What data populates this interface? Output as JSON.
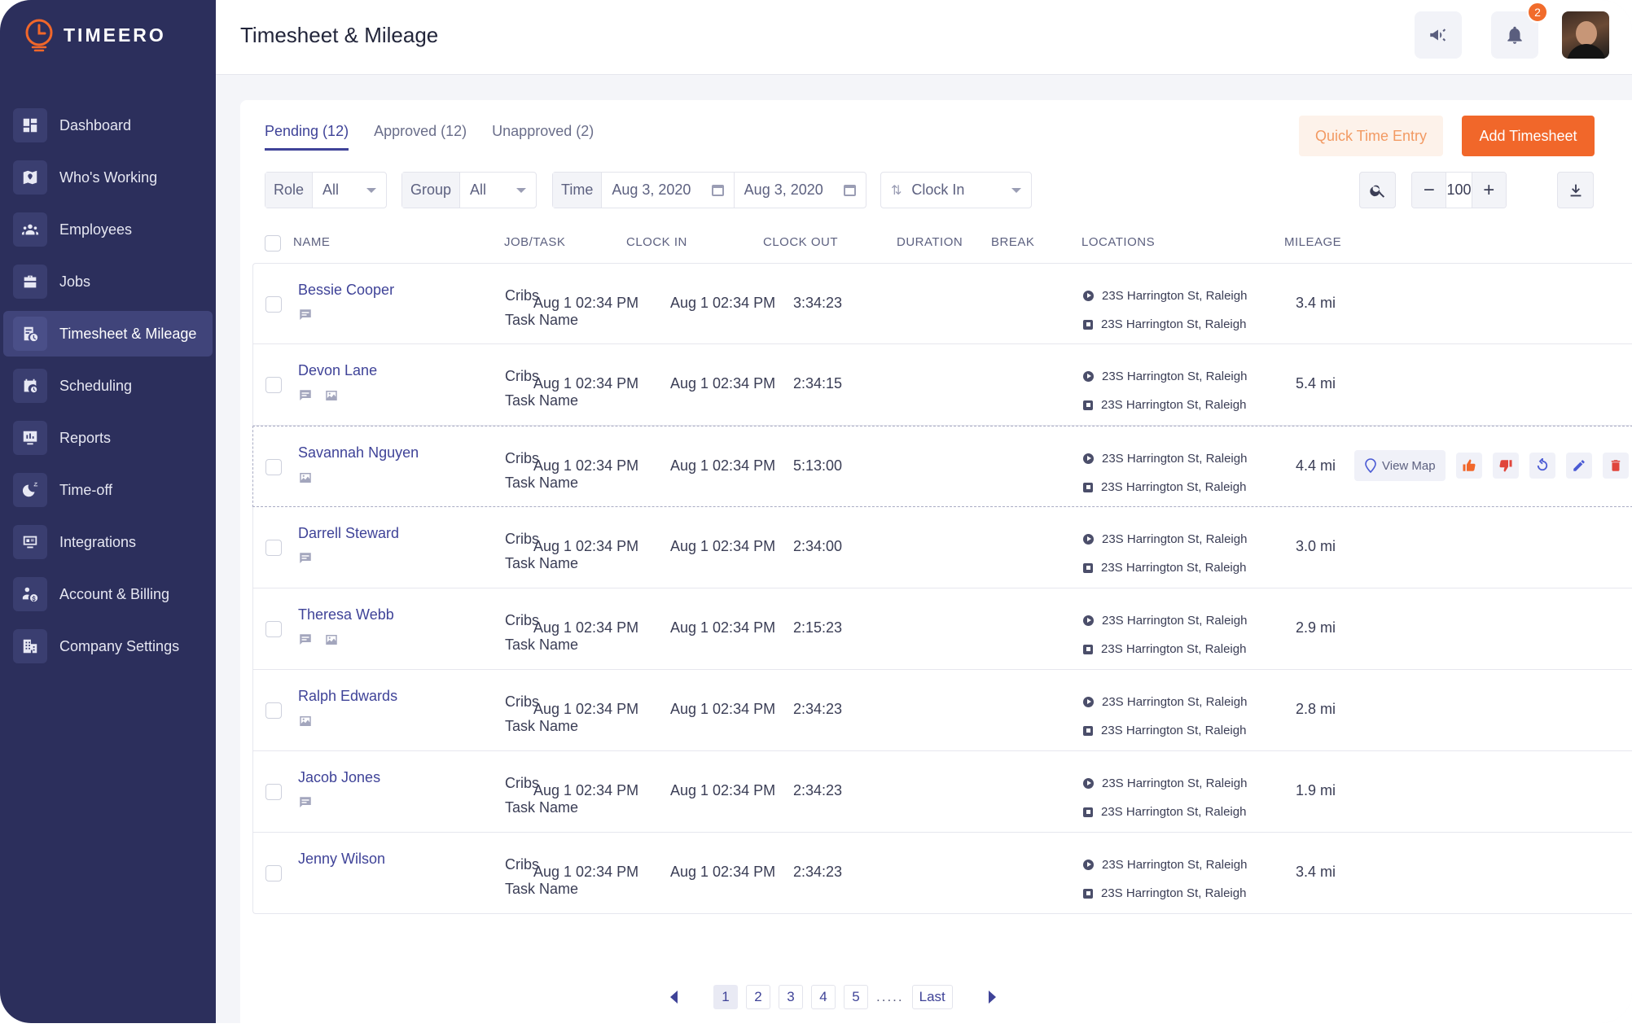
{
  "brand": {
    "name": "TIMEERO"
  },
  "header": {
    "title": "Timesheet & Mileage",
    "notification_count": "2"
  },
  "sidebar": {
    "items": [
      {
        "label": "Dashboard",
        "icon": "dashboard-icon"
      },
      {
        "label": "Who's Working",
        "icon": "map-icon"
      },
      {
        "label": "Employees",
        "icon": "employees-icon"
      },
      {
        "label": "Jobs",
        "icon": "briefcase-icon"
      },
      {
        "label": "Timesheet & Mileage",
        "icon": "timesheet-icon",
        "active": true
      },
      {
        "label": "Scheduling",
        "icon": "calendar-clock-icon"
      },
      {
        "label": "Reports",
        "icon": "reports-icon"
      },
      {
        "label": "Time-off",
        "icon": "time-off-icon"
      },
      {
        "label": "Integrations",
        "icon": "integrations-icon"
      },
      {
        "label": "Account & Billing",
        "icon": "billing-icon"
      },
      {
        "label": "Company Settings",
        "icon": "building-icon"
      }
    ]
  },
  "tabs": [
    {
      "label": "Pending (12)",
      "active": true
    },
    {
      "label": "Approved (12)"
    },
    {
      "label": "Unapproved (2)"
    }
  ],
  "buttons": {
    "quick_entry": "Quick Time Entry",
    "add_timesheet": "Add Timesheet"
  },
  "filters": {
    "role_label": "Role",
    "role_value": "All",
    "group_label": "Group",
    "group_value": "All",
    "time_label": "Time",
    "date_from": "Aug 3, 2020",
    "date_to": "Aug 3, 2020",
    "sort_value": "Clock In"
  },
  "zoom": {
    "value": "100",
    "minus": "−",
    "plus": "+"
  },
  "columns": {
    "name": "NAME",
    "job": "JOB/TASK",
    "clock_in": "CLOCK IN",
    "clock_out": "CLOCK OUT",
    "duration": "DURATION",
    "break": "BREAK",
    "locations": "LOCATIONS",
    "mileage": "MILEAGE"
  },
  "rows": [
    {
      "name": "Bessie Cooper",
      "job": "Cribs",
      "task": "Task Name",
      "clock_in": "Aug 1 02:34 PM",
      "clock_out": "Aug 1 02:34 PM",
      "duration": "3:34:23",
      "loc_start": "23S Harrington St, Raleigh",
      "loc_end": "23S Harrington St, Raleigh",
      "mileage": "3.4 mi",
      "icons": [
        "comment-icon"
      ]
    },
    {
      "name": "Devon Lane",
      "job": "Cribs",
      "task": "Task Name",
      "clock_in": "Aug 1 02:34 PM",
      "clock_out": "Aug 1 02:34 PM",
      "duration": "2:34:15",
      "loc_start": "23S Harrington St, Raleigh",
      "loc_end": "23S Harrington St, Raleigh",
      "mileage": "5.4 mi",
      "icons": [
        "comment-icon",
        "image-icon"
      ]
    },
    {
      "name": "Savannah Nguyen",
      "job": "Cribs",
      "task": "Task Name",
      "clock_in": "Aug 1 02:34 PM",
      "clock_out": "Aug 1 02:34 PM",
      "duration": "5:13:00",
      "loc_start": "23S Harrington St, Raleigh",
      "loc_end": "23S Harrington St, Raleigh",
      "mileage": "4.4 mi",
      "icons": [
        "image-icon"
      ],
      "highlight": true
    },
    {
      "name": "Darrell Steward",
      "job": "Cribs",
      "task": "Task Name",
      "clock_in": "Aug 1 02:34 PM",
      "clock_out": "Aug 1 02:34 PM",
      "duration": "2:34:00",
      "loc_start": "23S Harrington St, Raleigh",
      "loc_end": "23S Harrington St, Raleigh",
      "mileage": "3.0 mi",
      "icons": [
        "comment-icon"
      ]
    },
    {
      "name": "Theresa Webb",
      "job": "Cribs",
      "task": "Task Name",
      "clock_in": "Aug 1 02:34 PM",
      "clock_out": "Aug 1 02:34 PM",
      "duration": "2:15:23",
      "loc_start": "23S Harrington St, Raleigh",
      "loc_end": "23S Harrington St, Raleigh",
      "mileage": "2.9 mi",
      "icons": [
        "comment-icon",
        "image-icon"
      ]
    },
    {
      "name": "Ralph Edwards",
      "job": "Cribs",
      "task": "Task Name",
      "clock_in": "Aug 1 02:34 PM",
      "clock_out": "Aug 1 02:34 PM",
      "duration": "2:34:23",
      "loc_start": "23S Harrington St, Raleigh",
      "loc_end": "23S Harrington St, Raleigh",
      "mileage": "2.8 mi",
      "icons": [
        "image-icon"
      ]
    },
    {
      "name": "Jacob Jones",
      "job": "Cribs",
      "task": "Task Name",
      "clock_in": "Aug 1 02:34 PM",
      "clock_out": "Aug 1 02:34 PM",
      "duration": "2:34:23",
      "loc_start": "23S Harrington St, Raleigh",
      "loc_end": "23S Harrington St, Raleigh",
      "mileage": "1.9 mi",
      "icons": [
        "comment-icon"
      ]
    },
    {
      "name": "Jenny Wilson",
      "job": "Cribs",
      "task": "Task Name",
      "clock_in": "Aug 1 02:34 PM",
      "clock_out": "Aug 1 02:34 PM",
      "duration": "2:34:23",
      "loc_start": "23S Harrington St, Raleigh",
      "loc_end": "23S Harrington St, Raleigh",
      "mileage": "3.4 mi",
      "icons": []
    }
  ],
  "row_actions": {
    "view_map": "View Map"
  },
  "pagination": {
    "pages": [
      "1",
      "2",
      "3",
      "4",
      "5"
    ],
    "ellipsis": ".....",
    "last": "Last",
    "current": "1"
  },
  "colors": {
    "sidebar": "#2c2f5c",
    "accent": "#f1672a",
    "link": "#3f4398"
  }
}
